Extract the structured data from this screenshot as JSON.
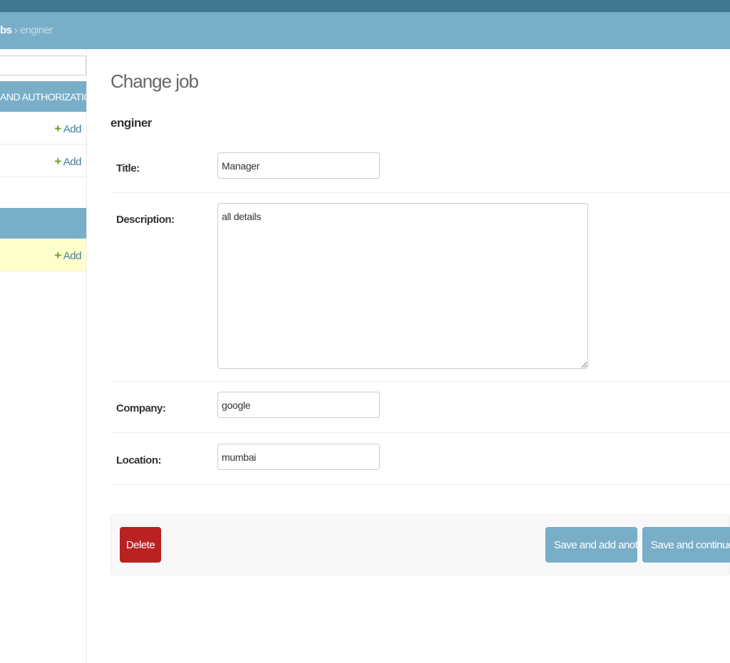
{
  "breadcrumbs": {
    "model": "bs",
    "separator": "›",
    "current": "enginer"
  },
  "sidebar": {
    "modules": [
      {
        "caption": "AND AUTHORIZATION",
        "models": [
          {
            "add_label": "Add"
          },
          {
            "add_label": "Add"
          }
        ]
      },
      {
        "caption": "",
        "models": [
          {
            "add_label": "Add",
            "current": true
          }
        ]
      }
    ]
  },
  "page": {
    "title": "Change job",
    "object_name": "enginer"
  },
  "form": {
    "title": {
      "label": "Title:",
      "value": "Manager"
    },
    "description": {
      "label": "Description:",
      "value": "all details"
    },
    "company": {
      "label": "Company:",
      "value": "google"
    },
    "location": {
      "label": "Location:",
      "value": "mumbai"
    }
  },
  "actions": {
    "delete": "Delete",
    "save_add_another": "Save and add another",
    "save_continue": "Save and continue editing"
  },
  "colors": {
    "header": "#417690",
    "breadcrumb_bar": "#79aec8",
    "delete_button": "#ba2121",
    "save_button": "#79aec8",
    "add_plus": "#5ea526",
    "current_row": "#ffffcc"
  }
}
